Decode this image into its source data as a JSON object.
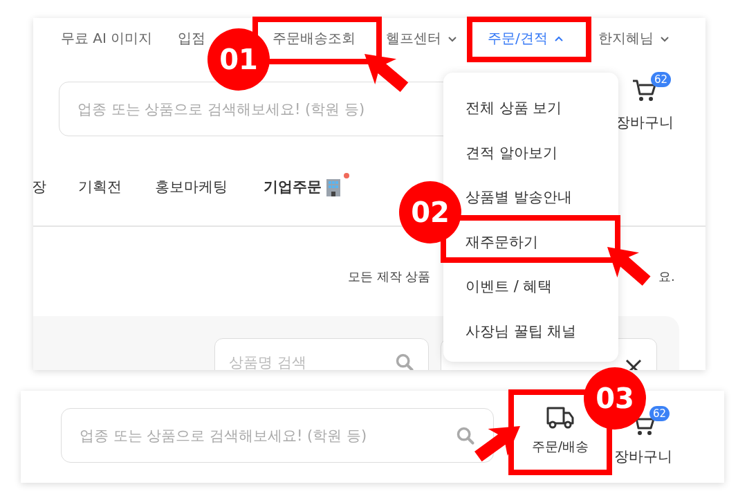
{
  "top_nav": [
    {
      "label": "무료 AI 이미지",
      "selected": false,
      "dropdown": false
    },
    {
      "label": "입점",
      "selected": false,
      "dropdown": false
    },
    {
      "label": "주문배송조회",
      "selected": false,
      "dropdown": false
    },
    {
      "label": "헬프센터",
      "selected": false,
      "dropdown": true
    },
    {
      "label": "주문/견적",
      "selected": true,
      "dropdown": true
    },
    {
      "label": "한지혜님",
      "selected": false,
      "dropdown": true
    }
  ],
  "search": {
    "placeholder": "업종 또는 상품으로 검색해보세요! (학원 등)"
  },
  "cart": {
    "label": "장바구니",
    "count": "62"
  },
  "categories": [
    {
      "label": "장",
      "bold": false,
      "new": false
    },
    {
      "label": "기획전",
      "bold": false,
      "new": false
    },
    {
      "label": "홍보마케팅",
      "bold": false,
      "new": false
    },
    {
      "label": "기업주문",
      "bold": true,
      "new": true
    }
  ],
  "notice": [
    "모든 제작 상품",
    "요."
  ],
  "filter": {
    "placeholder": "상품명 검색"
  },
  "dropdown_menu": [
    "전체 상품 보기",
    "견적 알아보기",
    "상품별 발송안내",
    "재주문하기",
    "이벤트 / 혜택",
    "사장님 꿀팁 채널"
  ],
  "bottom_header": {
    "search": {
      "placeholder": "업종 또는 상품으로 검색해보세요! (학원 등)"
    },
    "order": {
      "label": "주문/배송"
    },
    "cart": {
      "label": "장바구니",
      "count": "62"
    }
  },
  "steps": [
    "01",
    "02",
    "03"
  ]
}
